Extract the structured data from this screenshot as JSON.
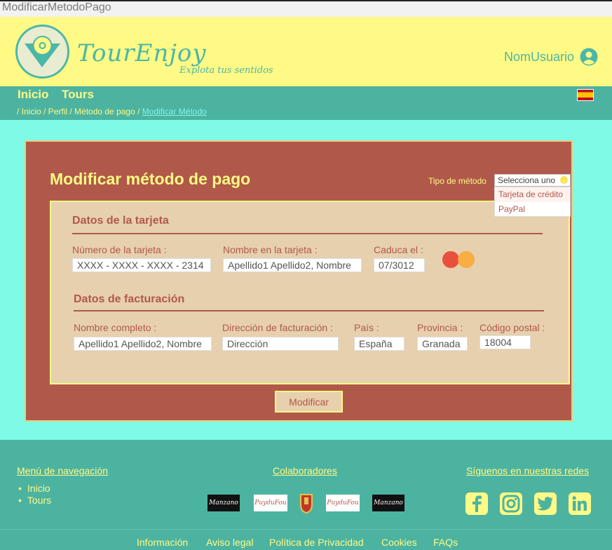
{
  "window": {
    "title": "ModificarMetodoPago"
  },
  "header": {
    "brand": "TourEnjoy",
    "tagline": "Explota tus sentidos",
    "username": "NomUsuario"
  },
  "nav": {
    "links": [
      "Inicio",
      "Tours"
    ],
    "breadcrumb": {
      "prefix": "/ Inicio / Perfil / Método de pago / ",
      "current": "Modificar Método"
    }
  },
  "form": {
    "title": "Modificar método de pago",
    "method_label": "Tipo de método",
    "method_select": "Selecciona uno",
    "method_options": [
      "Tarjeta de crédito",
      "PayPal"
    ],
    "card_section": {
      "title": "Datos de la tarjeta",
      "number_label": "Número de la tarjeta :",
      "number_value": "XXXX - XXXX - XXXX - 2314",
      "name_label": "Nombre en la tarjeta :",
      "name_value": "Apellido1 Apellido2, Nombre",
      "expiry_label": "Caduca el :",
      "expiry_value": "07/3012"
    },
    "billing_section": {
      "title": "Datos de facturación",
      "fullname_label": "Nombre completo :",
      "fullname_value": "Apellido1 Apellido2, Nombre",
      "address_label": "Dirección de facturación :",
      "address_value": "Dirección",
      "country_label": "País :",
      "country_value": "España",
      "province_label": "Provincia :",
      "province_value": "Granada",
      "postal_label": "Código postal :",
      "postal_value": "18004"
    },
    "submit_label": "Modificar"
  },
  "footer": {
    "nav_title": "Menú de navegación",
    "nav_links": [
      "Inicio",
      "Tours"
    ],
    "collab_title": "Colaboradores",
    "collab_logos": [
      "Manzano",
      "PuyduFou",
      "PuyduFou",
      "Manzano"
    ],
    "social_title": "Síguenos en nuestras redes",
    "social_icons": [
      "facebook-icon",
      "instagram-icon",
      "twitter-icon",
      "linkedin-icon"
    ],
    "bottom_links": [
      "Información",
      "Aviso legal",
      "Política de Privacidad",
      "Cookies",
      "FAQs"
    ]
  },
  "colors": {
    "header_bg": "#fff985",
    "teal": "#4db3a1",
    "main_bg": "#7ffae7",
    "panel_bg": "#b0594a",
    "card_bg": "#e7d0ad"
  }
}
